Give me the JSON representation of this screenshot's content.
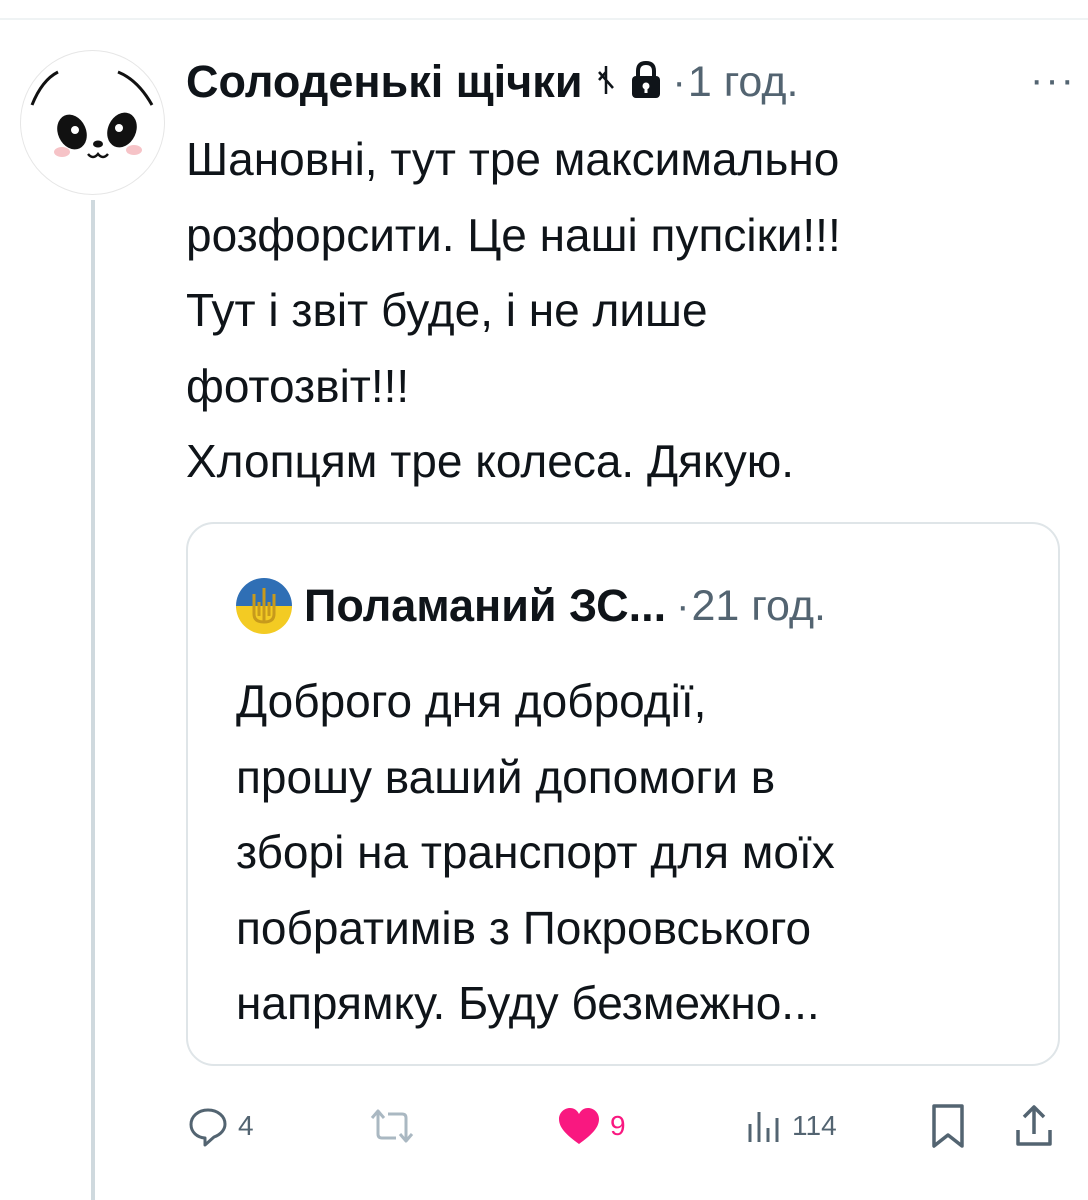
{
  "tweet": {
    "display_name": "Солоденькі щічки",
    "time": "1 год.",
    "separator": "·",
    "more_label": "···",
    "text_lines": [
      "Шановні, тут тре максимально",
      "розфорсити. Це наші пупсіки!!!",
      "Тут і звіт буде, і не лише",
      "фотозвіт!!!",
      "Хлопцям тре колеса. Дякую."
    ],
    "avatar_icon": "panda-avatar",
    "name_icons": [
      "rune-icon",
      "lock-icon"
    ]
  },
  "quote": {
    "display_name": "Поламаний ЗС...",
    "time": "21 год.",
    "separator": "·",
    "avatar_icon": "ukraine-trident-flag-avatar",
    "text_lines": [
      "Доброго дня добродії,",
      "прошу ваший допомоги в",
      "зборі на транспорт для моїх",
      "побратимів з Покровського",
      "напрямку. Буду безмежно..."
    ]
  },
  "actions": {
    "reply_count": "4",
    "retweet_count": "",
    "like_count": "9",
    "views_count": "114",
    "like_color": "#f91880",
    "icon_color": "#536471"
  }
}
